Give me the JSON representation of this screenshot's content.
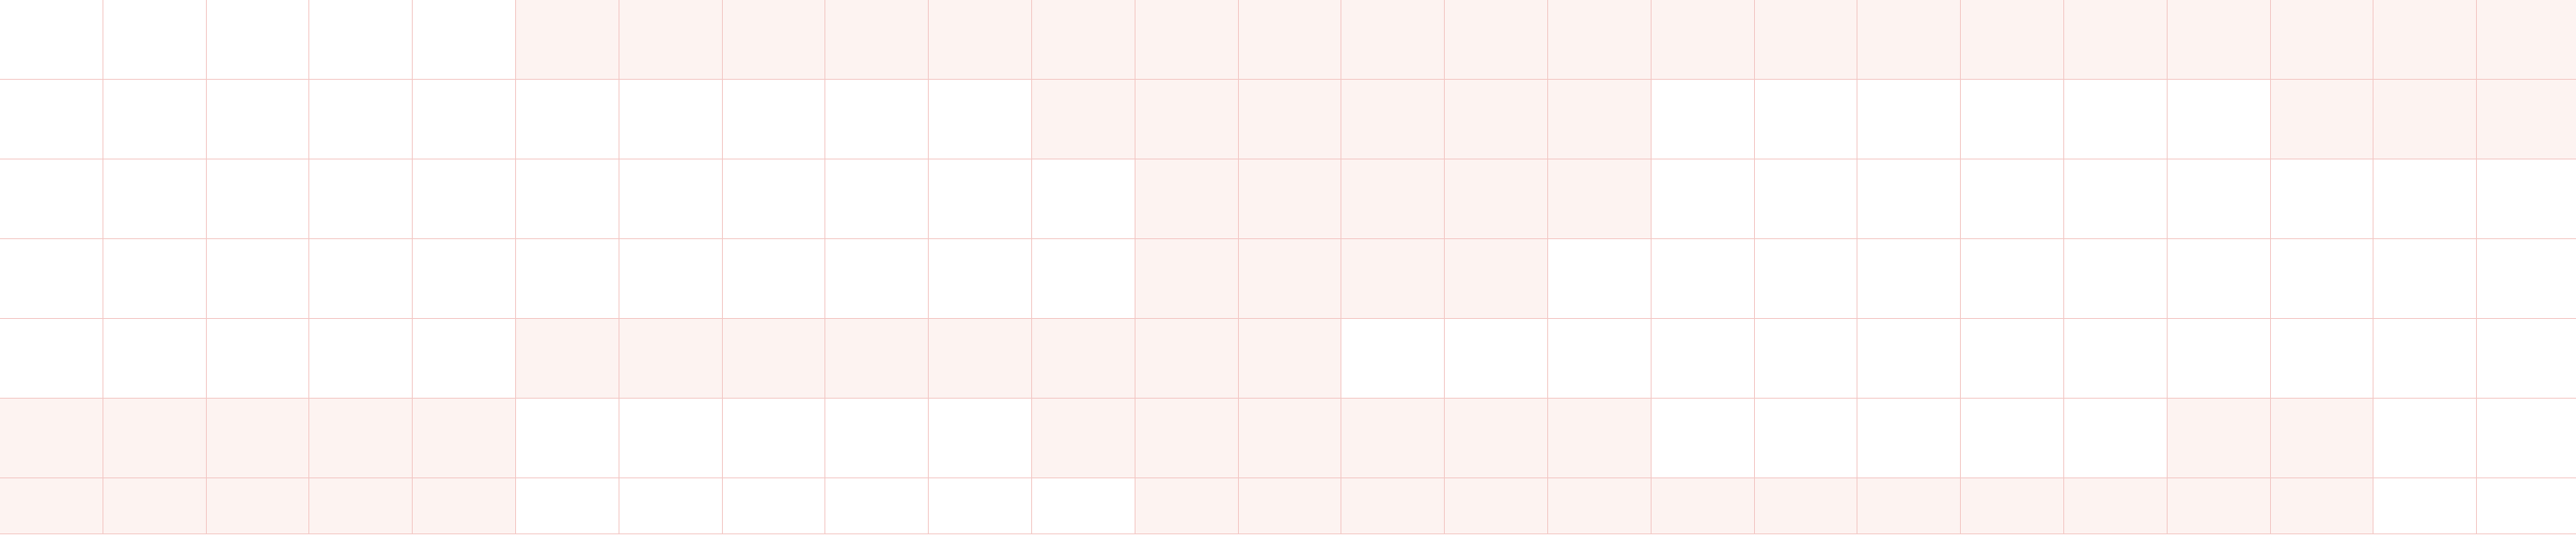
{
  "grid": {
    "rows": 7,
    "cols": 25,
    "colors": {
      "line": "#f3c7c4",
      "shaded_fill": "#fdf3f1",
      "empty_fill": "#ffffff"
    },
    "shaded": [
      "0000011111111111111111111",
      "0000000000111111000000111",
      "0000000000011111000000000",
      "0000000000011110000000000",
      "0000011111111000000000000",
      "1111100000111111000001100",
      "1111100000011111111111100"
    ]
  }
}
